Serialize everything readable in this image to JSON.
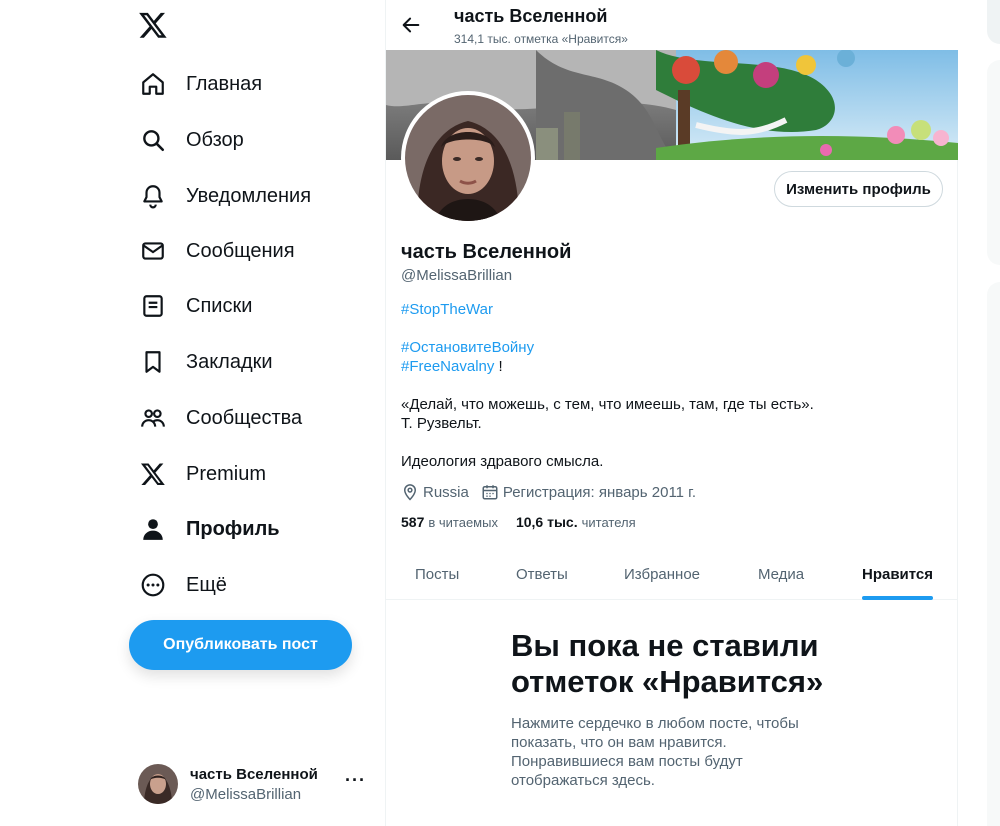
{
  "sidebar": {
    "logo": "x-logo-icon",
    "items": [
      {
        "label": "Главная",
        "icon": "home-icon"
      },
      {
        "label": "Обзор",
        "icon": "search-icon"
      },
      {
        "label": "Уведомления",
        "icon": "bell-icon"
      },
      {
        "label": "Сообщения",
        "icon": "envelope-icon"
      },
      {
        "label": "Списки",
        "icon": "list-icon"
      },
      {
        "label": "Закладки",
        "icon": "bookmark-icon"
      },
      {
        "label": "Сообщества",
        "icon": "communities-icon"
      },
      {
        "label": "Premium",
        "icon": "x-logo-icon"
      },
      {
        "label": "Профиль",
        "icon": "person-icon",
        "active": true
      },
      {
        "label": "Ещё",
        "icon": "more-circle-icon"
      }
    ],
    "publish_label": "Опубликовать пост",
    "account": {
      "name": "часть Вселенной",
      "handle": "@MelissaBrillian",
      "more": "···"
    }
  },
  "header": {
    "title": "часть Вселенной",
    "subtitle": "314,1 тыс. отметка «Нравится»"
  },
  "profile": {
    "edit_label": "Изменить профиль",
    "name": "часть Вселенной",
    "handle": "@MelissaBrillian",
    "bio": {
      "tag1": "#StopTheWar",
      "tag2": "#ОстановитеВойну",
      "tag3": "#FreeNavalny",
      "tag3_suffix": " !",
      "quote": "«Делай, что можешь, с тем, что имеешь, там, где ты есть».",
      "author": "Т. Рузвельт.",
      "ideology": "Идеология здравого смысла."
    },
    "location": "Russia",
    "joined": "Регистрация: январь 2011 г.",
    "following_count": "587",
    "following_label": "в читаемых",
    "followers_count": "10,6 тыс.",
    "followers_label": "читателя"
  },
  "tabs": [
    {
      "label": "Посты"
    },
    {
      "label": "Ответы"
    },
    {
      "label": "Избранное"
    },
    {
      "label": "Медиа"
    },
    {
      "label": "Нравится",
      "active": true
    }
  ],
  "empty_state": {
    "title": "Вы пока не ставили отметок «Нравится»",
    "text": "Нажмите сердечко в любом посте, чтобы показать, что он вам нравится. Понравившиеся вам посты будут отображаться здесь."
  },
  "colors": {
    "accent": "#1d9bf0",
    "text": "#0f1419",
    "muted": "#536471",
    "border": "#cfd9de"
  }
}
